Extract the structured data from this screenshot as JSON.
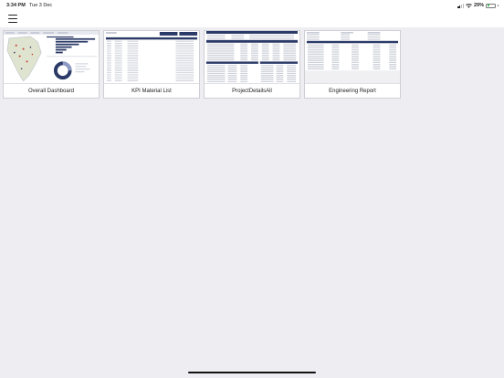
{
  "status_bar": {
    "time": "3:34 PM",
    "date": "Tue 3 Dec",
    "battery_percent": "29%",
    "battery_level": 0.29,
    "icons": [
      "cellular-signal-icon",
      "wifi-icon",
      "battery-icon"
    ]
  },
  "nav": {
    "menu_icon": "hamburger-menu-icon"
  },
  "reports": [
    {
      "title": "Overall Dashboard"
    },
    {
      "title": "KPI Material List"
    },
    {
      "title": "ProjectDetailsAll"
    },
    {
      "title": "Engineering Report"
    }
  ],
  "colors": {
    "background": "#eeeef2",
    "card_header": "#2b3a67",
    "battery_fill": "#35c759"
  }
}
